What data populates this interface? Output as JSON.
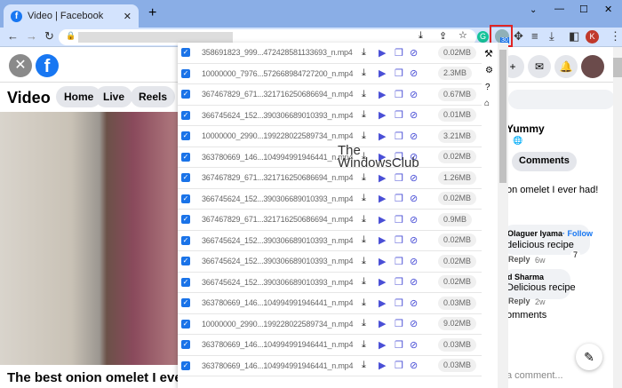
{
  "browser": {
    "tab_title": "Video | Facebook",
    "new_tab": "+",
    "ext_badge": "30",
    "profile_initial": "K"
  },
  "fb": {
    "section_title": "Video",
    "nav": [
      "Home",
      "Live",
      "Reels"
    ],
    "video_title": "The best onion omelet I ever ha",
    "post_name": "Yummy",
    "comments_button": "Comments",
    "post_text": "on omelet I ever had!",
    "comments": [
      {
        "author": "Olaguer Iyama",
        "follow": "· Follow",
        "text": "delicious recipe",
        "reply": "Reply",
        "time": "6w",
        "likes": "7"
      },
      {
        "author": "d Sharma",
        "text": "Delicious recipe",
        "reply": "Reply",
        "time": "2w"
      }
    ],
    "more_comments": "omments",
    "comment_placeholder": "a comment..."
  },
  "popup": {
    "files": [
      {
        "name": "358691823_999...472428581133693_n.mp4",
        "size": "0.02MB"
      },
      {
        "name": "10000000_7976...572668984727200_n.mp4",
        "size": "2.3MB"
      },
      {
        "name": "367467829_671...321716250686694_n.mp4",
        "size": "0.67MB"
      },
      {
        "name": "366745624_152...390306689010393_n.mp4",
        "size": "0.01MB"
      },
      {
        "name": "10000000_2990...199228022589734_n.mp4",
        "size": "3.21MB"
      },
      {
        "name": "363780669_146...104994991946441_n.mp4",
        "size": "0.02MB"
      },
      {
        "name": "367467829_671...321716250686694_n.mp4",
        "size": "1.26MB"
      },
      {
        "name": "366745624_152...390306689010393_n.mp4",
        "size": "0.02MB"
      },
      {
        "name": "367467829_671...321716250686694_n.mp4",
        "size": "0.9MB"
      },
      {
        "name": "366745624_152...390306689010393_n.mp4",
        "size": "0.02MB"
      },
      {
        "name": "366745624_152...390306689010393_n.mp4",
        "size": "0.02MB"
      },
      {
        "name": "366745624_152...390306689010393_n.mp4",
        "size": "0.02MB"
      },
      {
        "name": "363780669_146...104994991946441_n.mp4",
        "size": "0.03MB"
      },
      {
        "name": "10000000_2990...199228022589734_n.mp4",
        "size": "9.02MB"
      },
      {
        "name": "363780669_146...104994991946441_n.mp4",
        "size": "0.03MB"
      },
      {
        "name": "363780669_146...104994991946441_n.mp4",
        "size": "0.03MB"
      }
    ]
  },
  "watermark": {
    "line1": "The",
    "line2": "WindowsClub"
  },
  "colors": {
    "accent": "#1a73e8",
    "action": "#4a4fd6",
    "fb": "#1877f2"
  }
}
